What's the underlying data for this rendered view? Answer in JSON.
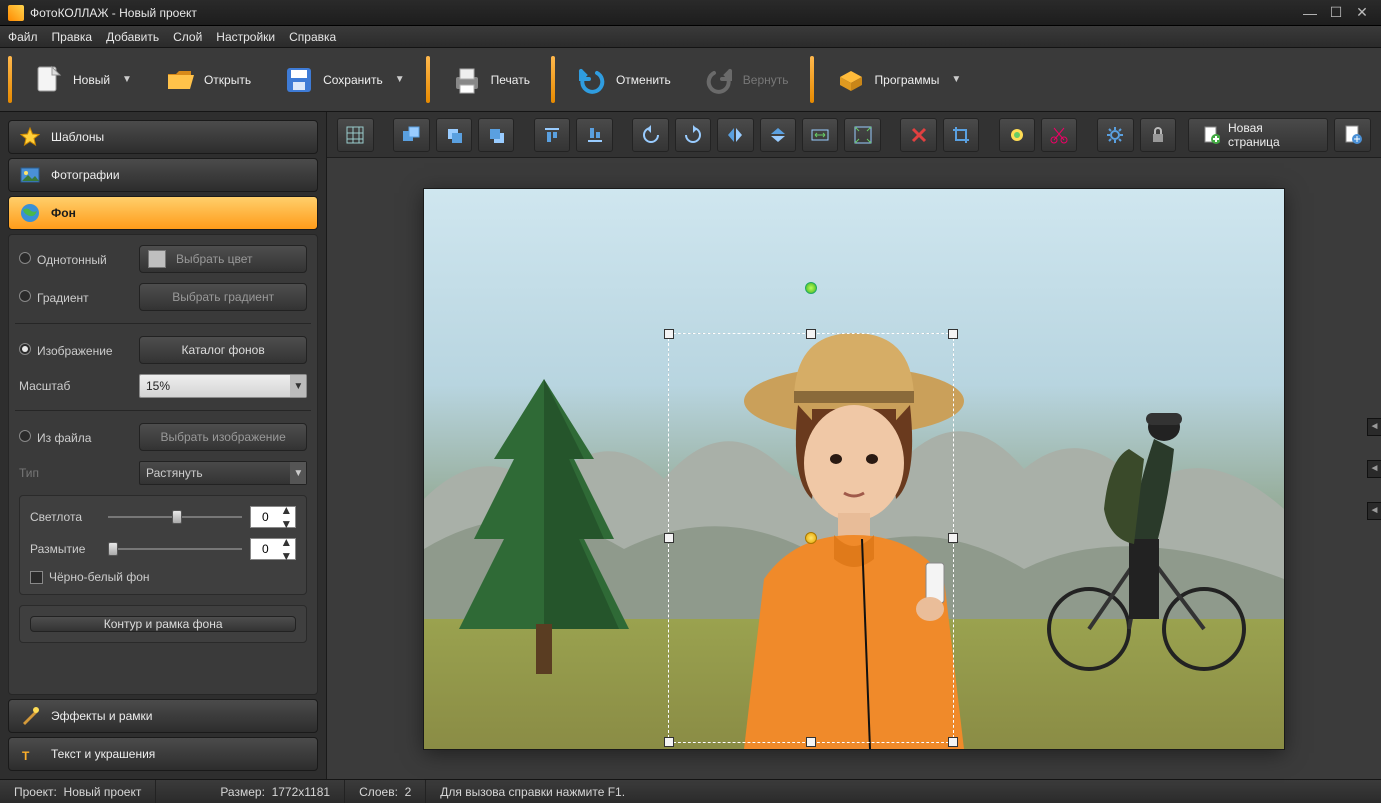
{
  "title": "ФотоКОЛЛАЖ - Новый проект",
  "menu": [
    "Файл",
    "Правка",
    "Добавить",
    "Слой",
    "Настройки",
    "Справка"
  ],
  "toolbar": [
    {
      "id": "new",
      "label": "Новый",
      "dropdown": true
    },
    {
      "id": "open",
      "label": "Открыть"
    },
    {
      "id": "save",
      "label": "Сохранить",
      "dropdown": true
    },
    {
      "id": "print",
      "label": "Печать"
    },
    {
      "id": "undo",
      "label": "Отменить"
    },
    {
      "id": "redo",
      "label": "Вернуть",
      "disabled": true
    },
    {
      "id": "programs",
      "label": "Программы",
      "dropdown": true
    }
  ],
  "sidebar": {
    "sections": [
      {
        "id": "templates",
        "label": "Шаблоны",
        "icon": "star"
      },
      {
        "id": "photos",
        "label": "Фотографии",
        "icon": "photo"
      },
      {
        "id": "background",
        "label": "Фон",
        "icon": "globe",
        "active": true
      },
      {
        "id": "effects",
        "label": "Эффекты и рамки",
        "icon": "magic"
      },
      {
        "id": "text",
        "label": "Текст и украшения",
        "icon": "text"
      }
    ],
    "bg": {
      "solid_label": "Однотонный",
      "choose_color": "Выбрать цвет",
      "gradient_label": "Градиент",
      "choose_gradient": "Выбрать градиент",
      "image_label": "Изображение",
      "catalog_btn": "Каталог фонов",
      "scale_label": "Масштаб",
      "scale_value": "15%",
      "fromfile_label": "Из файла",
      "choose_image": "Выбрать изображение",
      "type_label": "Тип",
      "type_value": "Растянуть",
      "brightness_label": "Светлота",
      "brightness_value": "0",
      "blur_label": "Размытие",
      "blur_value": "0",
      "bw_label": "Чёрно-белый фон",
      "contour_btn": "Контур и рамка фона"
    }
  },
  "tool2": {
    "newpage": "Новая страница"
  },
  "status": {
    "project_label": "Проект:",
    "project_value": "Новый проект",
    "size_label": "Размер:",
    "size_value": "1772x1181",
    "layers_label": "Слоев:",
    "layers_value": "2",
    "help": "Для вызова справки нажмите F1."
  }
}
